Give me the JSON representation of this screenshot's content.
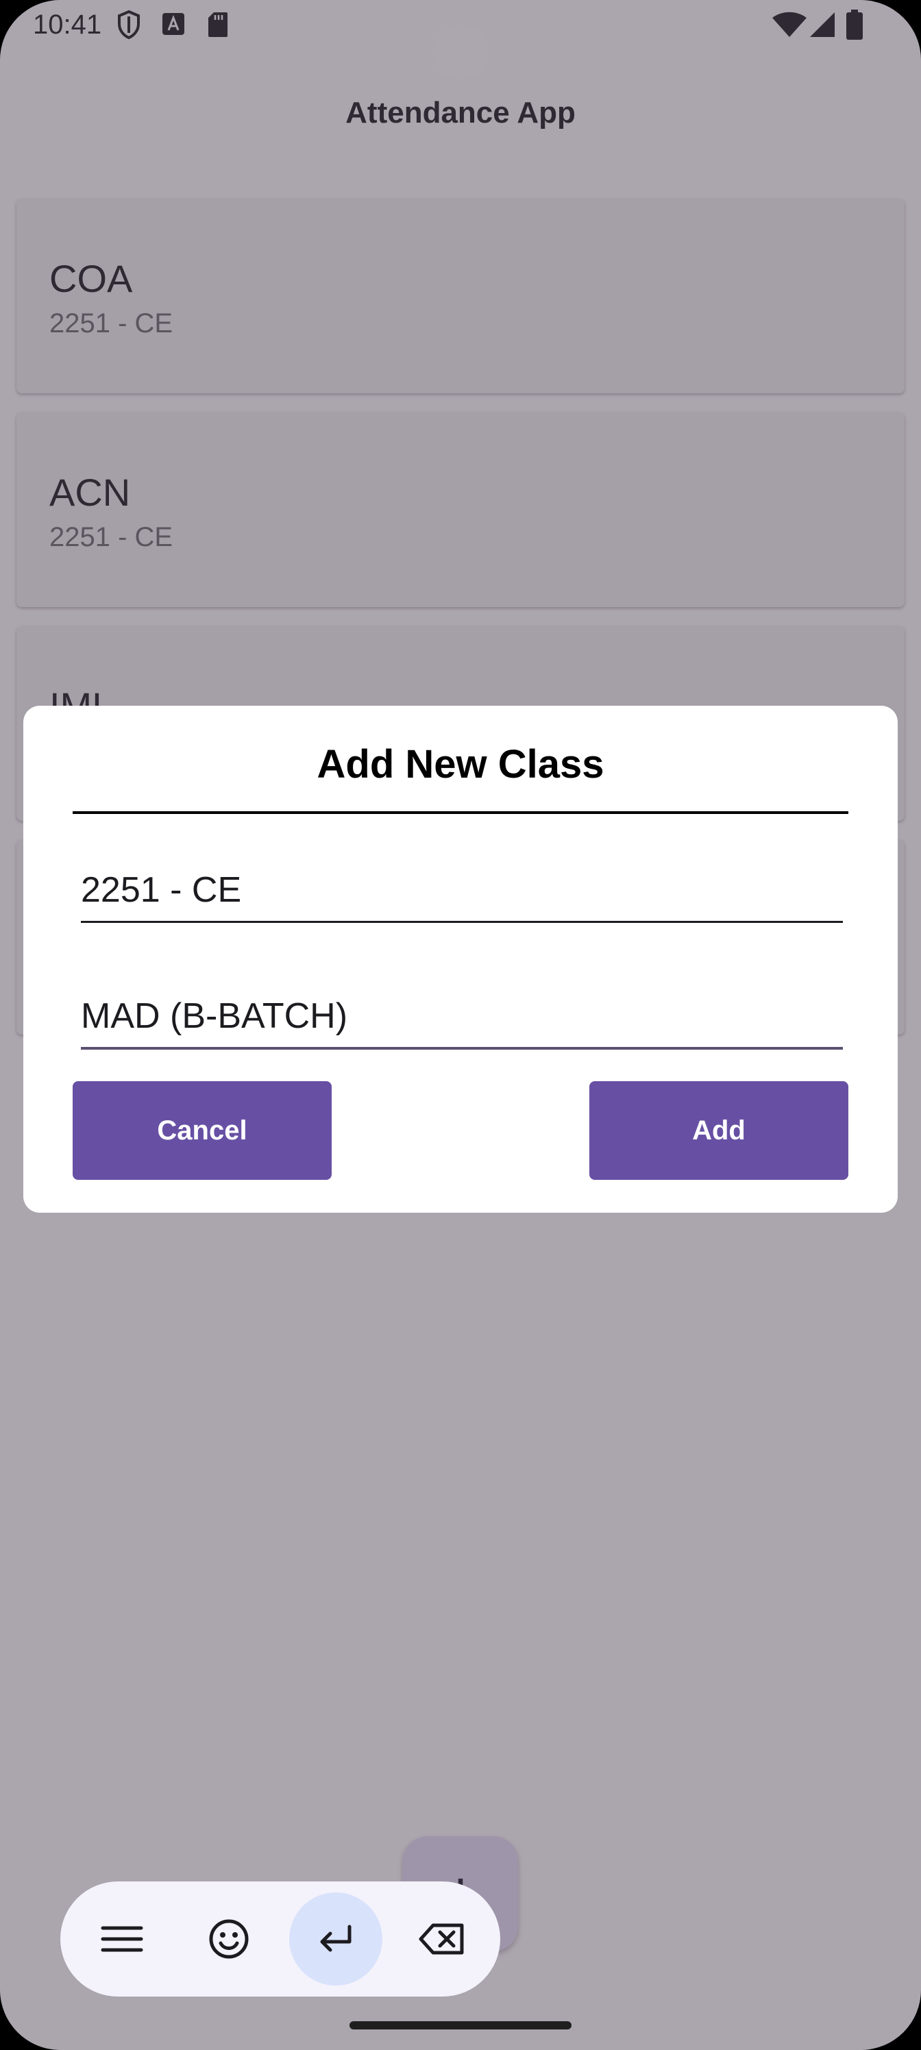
{
  "status_bar": {
    "time": "10:41",
    "icons": [
      "shield-icon",
      "font-a-icon",
      "sd-card-icon",
      "wifi-icon",
      "signal-icon",
      "battery-icon"
    ]
  },
  "app": {
    "title": "Attendance App"
  },
  "class_list": [
    {
      "name": "COA",
      "subtitle": "2251 - CE"
    },
    {
      "name": "ACN",
      "subtitle": "2251 - CE"
    },
    {
      "name": "IML",
      "subtitle": ""
    },
    {
      "name": "",
      "subtitle": ""
    }
  ],
  "fab": {
    "icon": "add-icon",
    "glyph": "+"
  },
  "dialog": {
    "title": "Add New Class",
    "batch_field": {
      "value": "2251 - CE"
    },
    "subject_field": {
      "value": "MAD (B-BATCH)"
    },
    "cancel_label": "Cancel",
    "add_label": "Add"
  },
  "keyboard_toolbar": {
    "buttons": [
      "menu-icon",
      "emoji-icon",
      "enter-icon",
      "backspace-icon"
    ]
  },
  "colors": {
    "primary": "#6750a4",
    "scrim": "rgba(70,60,75,0.45)",
    "dialog_bg": "#ffffff",
    "toolbar_highlight": "#d9e2fb"
  }
}
